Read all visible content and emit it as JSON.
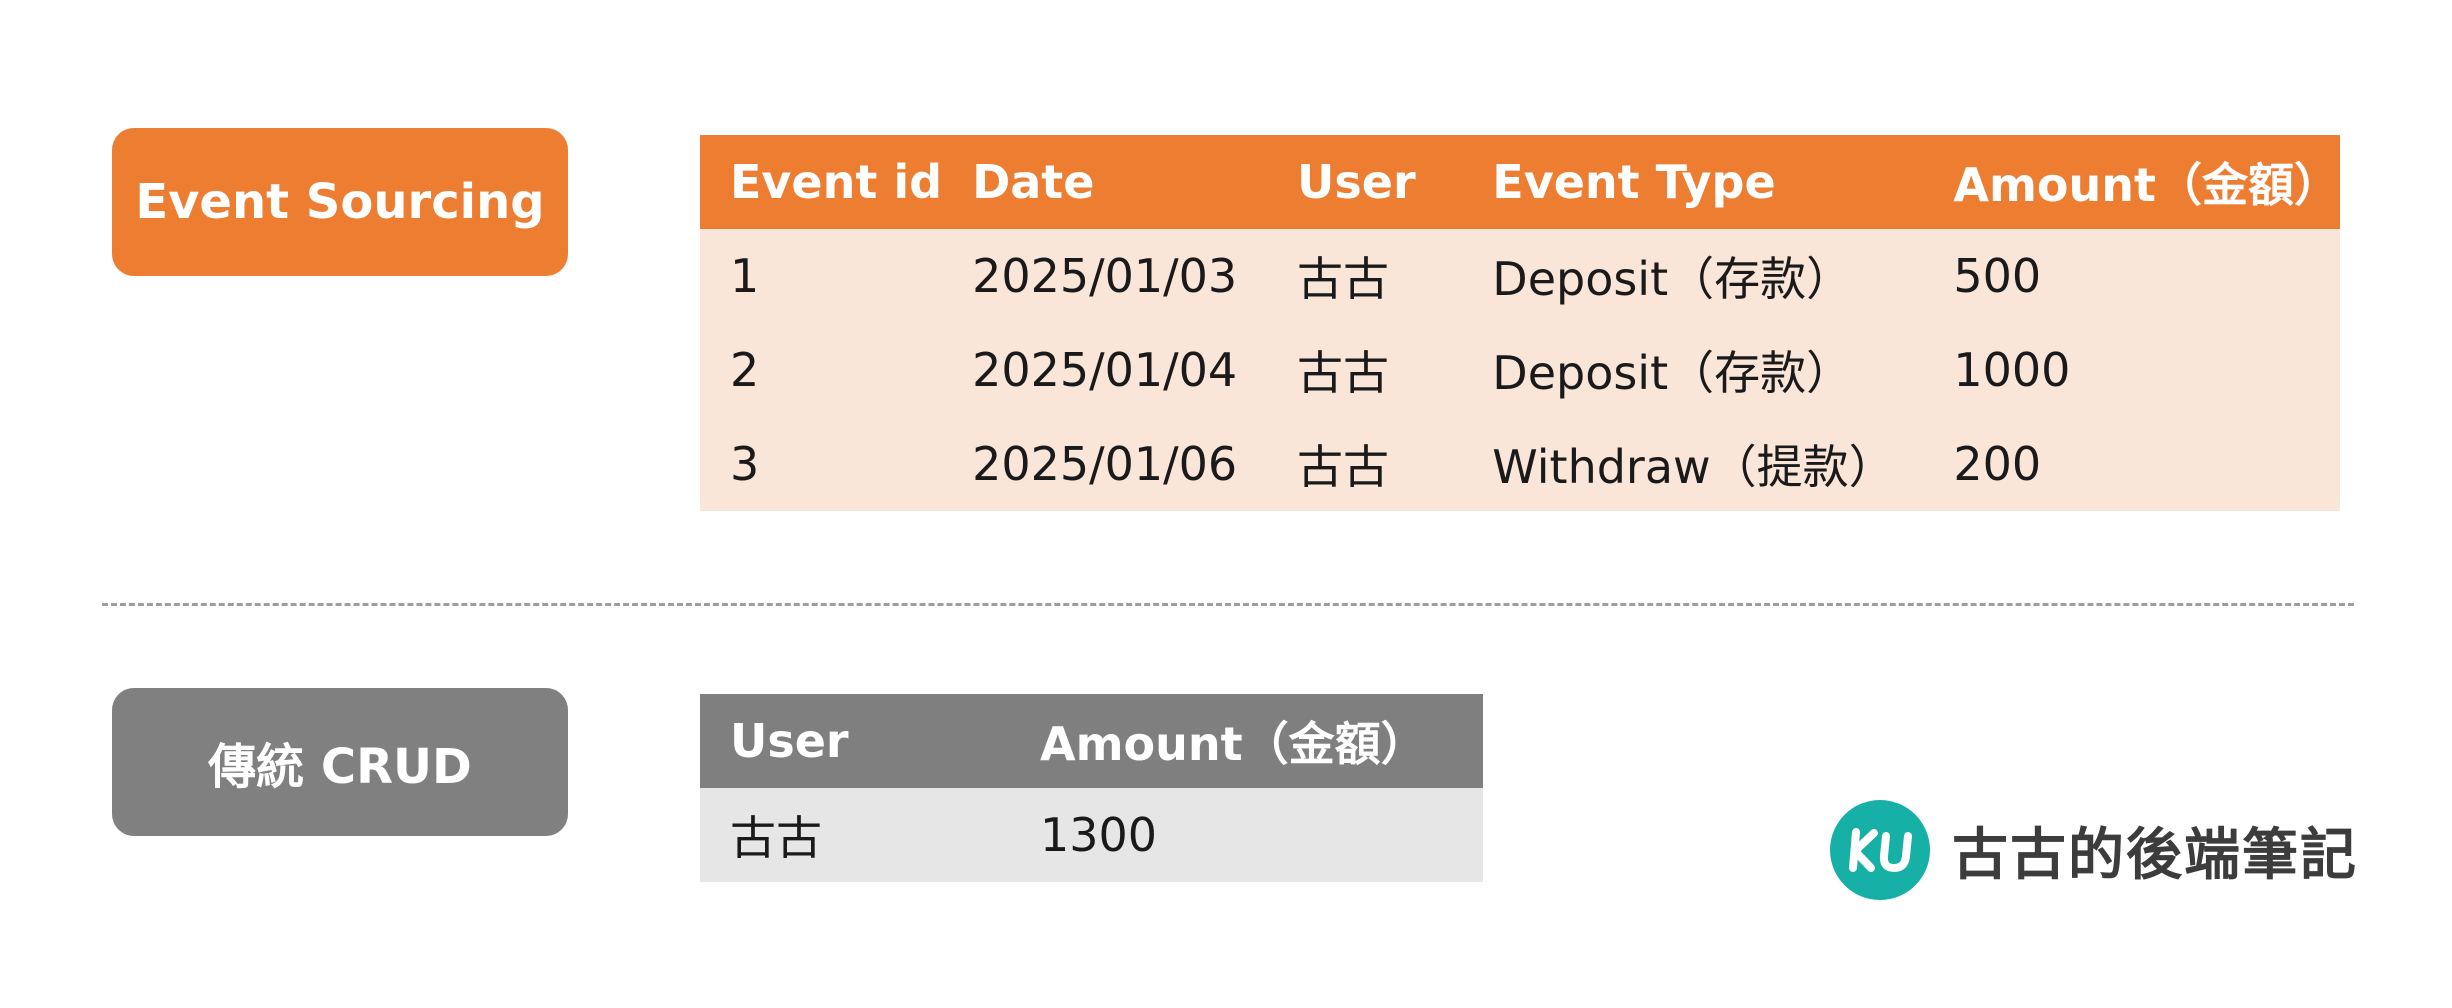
{
  "event_sourcing": {
    "label": "Event Sourcing",
    "headers": [
      "Event id",
      "Date",
      "User",
      "Event Type",
      "Amount（金額）"
    ],
    "rows": [
      [
        "1",
        "2025/01/03",
        "古古",
        "Deposit（存款）",
        "500"
      ],
      [
        "2",
        "2025/01/04",
        "古古",
        "Deposit（存款）",
        "1000"
      ],
      [
        "3",
        "2025/01/06",
        "古古",
        "Withdraw（提款）",
        "200"
      ]
    ]
  },
  "crud": {
    "label": "傳統 CRUD",
    "headers": [
      "User",
      "Amount（金額）"
    ],
    "rows": [
      [
        "古古",
        "1300"
      ]
    ]
  },
  "brand": {
    "logo_text": "KU",
    "name": "古古的後端筆記",
    "logo_icon": "ku-logo-icon"
  },
  "colors": {
    "event_sourcing_accent": "#ED7D31",
    "event_sourcing_row": "#FAE5D9",
    "crud_accent": "#808080",
    "crud_row": "#E6E6E6",
    "logo_teal": "#17B0A6"
  }
}
